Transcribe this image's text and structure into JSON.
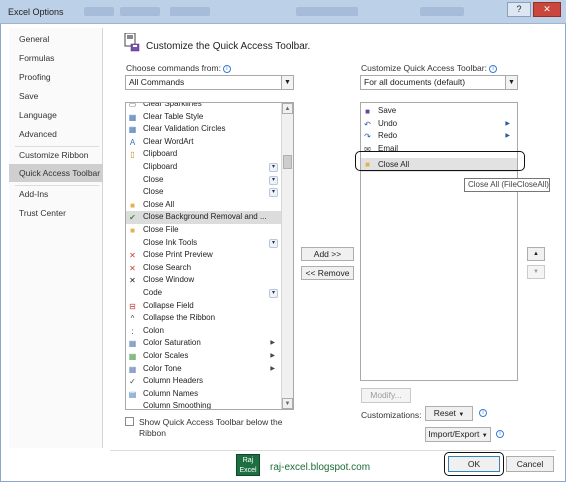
{
  "window": {
    "title": "Excel Options",
    "help_label": "?",
    "close_label": "✕"
  },
  "sidebar": {
    "items": [
      {
        "label": "General"
      },
      {
        "label": "Formulas"
      },
      {
        "label": "Proofing"
      },
      {
        "label": "Save"
      },
      {
        "label": "Language"
      },
      {
        "label": "Advanced"
      },
      {
        "label": "Customize Ribbon"
      },
      {
        "label": "Quick Access Toolbar"
      },
      {
        "label": "Add-Ins"
      },
      {
        "label": "Trust Center"
      }
    ],
    "selected_index": 7
  },
  "main": {
    "title": "Customize the Quick Access Toolbar.",
    "choose_label": "Choose commands from:",
    "choose_value": "All Commands",
    "customize_label": "Customize Quick Access Toolbar:",
    "customize_value": "For all documents (default)",
    "commands": [
      {
        "label": "Clear Sparklines",
        "icon": "sparkline-clear-icon",
        "glyph": "▭",
        "color": "#666"
      },
      {
        "label": "Clear Table Style",
        "icon": "table-style-icon",
        "glyph": "▦",
        "color": "#3a6fb0"
      },
      {
        "label": "Clear Validation Circles",
        "icon": "validation-icon",
        "glyph": "▦",
        "color": "#3a6fb0"
      },
      {
        "label": "Clear WordArt",
        "icon": "wordart-icon",
        "glyph": "A",
        "color": "#3a6fb0"
      },
      {
        "label": "Clipboard",
        "icon": "clipboard-icon",
        "glyph": "▯",
        "color": "#d28a1f"
      },
      {
        "label": "Clipboard",
        "icon": "",
        "glyph": "",
        "color": "#222",
        "split": true
      },
      {
        "label": "Close",
        "icon": "",
        "glyph": "",
        "color": "#222",
        "split": true
      },
      {
        "label": "Close",
        "icon": "",
        "glyph": "",
        "color": "#222",
        "split": true
      },
      {
        "label": "Close All",
        "icon": "folder-icon",
        "glyph": "■",
        "color": "#e3b24d"
      },
      {
        "label": "Close Background Removal and ...",
        "icon": "checkmark-icon",
        "glyph": "✔",
        "color": "#2f9a3a",
        "selected": true
      },
      {
        "label": "Close File",
        "icon": "folder-icon",
        "glyph": "■",
        "color": "#e3b24d"
      },
      {
        "label": "Close Ink Tools",
        "icon": "",
        "glyph": "",
        "color": "#222",
        "split": true
      },
      {
        "label": "Close Print Preview",
        "icon": "close-red-icon",
        "glyph": "✕",
        "color": "#d33a2c"
      },
      {
        "label": "Close Search",
        "icon": "close-red-icon",
        "glyph": "✕",
        "color": "#d33a2c"
      },
      {
        "label": "Close Window",
        "icon": "close-icon",
        "glyph": "✕",
        "color": "#222"
      },
      {
        "label": "Code",
        "icon": "",
        "glyph": "",
        "color": "#222",
        "split": true
      },
      {
        "label": "Collapse Field",
        "icon": "collapse-field-icon",
        "glyph": "⊟",
        "color": "#c0392b"
      },
      {
        "label": "Collapse the Ribbon",
        "icon": "chevron-up-icon",
        "glyph": "^",
        "color": "#444"
      },
      {
        "label": "Colon",
        "icon": "colon-icon",
        "glyph": ":",
        "color": "#222"
      },
      {
        "label": "Color Saturation",
        "icon": "saturation-icon",
        "glyph": "▦",
        "color": "#5a7ab0",
        "submenu": true
      },
      {
        "label": "Color Scales",
        "icon": "color-scales-icon",
        "glyph": "▦",
        "color": "#4e9a4e",
        "submenu": true
      },
      {
        "label": "Color Tone",
        "icon": "color-tone-icon",
        "glyph": "▦",
        "color": "#5a7ab0",
        "submenu": true
      },
      {
        "label": "Column Headers",
        "icon": "checkmark-icon",
        "glyph": "✓",
        "color": "#444"
      },
      {
        "label": "Column Names",
        "icon": "table-icon",
        "glyph": "▤",
        "color": "#3a6fb0"
      },
      {
        "label": "Column Smoothing",
        "icon": "",
        "glyph": "",
        "color": "#222"
      }
    ],
    "toolbar_items": [
      {
        "label": "Save",
        "icon": "save-icon",
        "glyph": "■",
        "color": "#6b3fa0"
      },
      {
        "label": "Undo",
        "icon": "undo-icon",
        "glyph": "↶",
        "color": "#2c5aa0",
        "submenu": true
      },
      {
        "label": "Redo",
        "icon": "redo-icon",
        "glyph": "↷",
        "color": "#2c5aa0",
        "submenu": true
      },
      {
        "label": "Email",
        "icon": "email-icon",
        "glyph": "✉",
        "color": "#444"
      },
      {
        "label": "Close All",
        "icon": "folder-icon",
        "glyph": "■",
        "color": "#e3b24d",
        "selected": true
      }
    ],
    "tooltip": "Close All (FileCloseAll)",
    "add_label": "Add >>",
    "remove_label": "<< Remove",
    "modify_label": "Modify...",
    "customizations_label": "Customizations:",
    "reset_label": "Reset",
    "import_export_label": "Import/Export",
    "show_below_line1": "Show Quick Access Toolbar below the",
    "show_below_line2": "Ribbon",
    "show_below_checked": false,
    "move_up_label": "▲",
    "move_down_label": "▼"
  },
  "footer": {
    "ok_label": "OK",
    "cancel_label": "Cancel",
    "logo_line1": "Raj",
    "logo_line2": "Excel",
    "watermark": "raj-excel.blogspot.com"
  }
}
